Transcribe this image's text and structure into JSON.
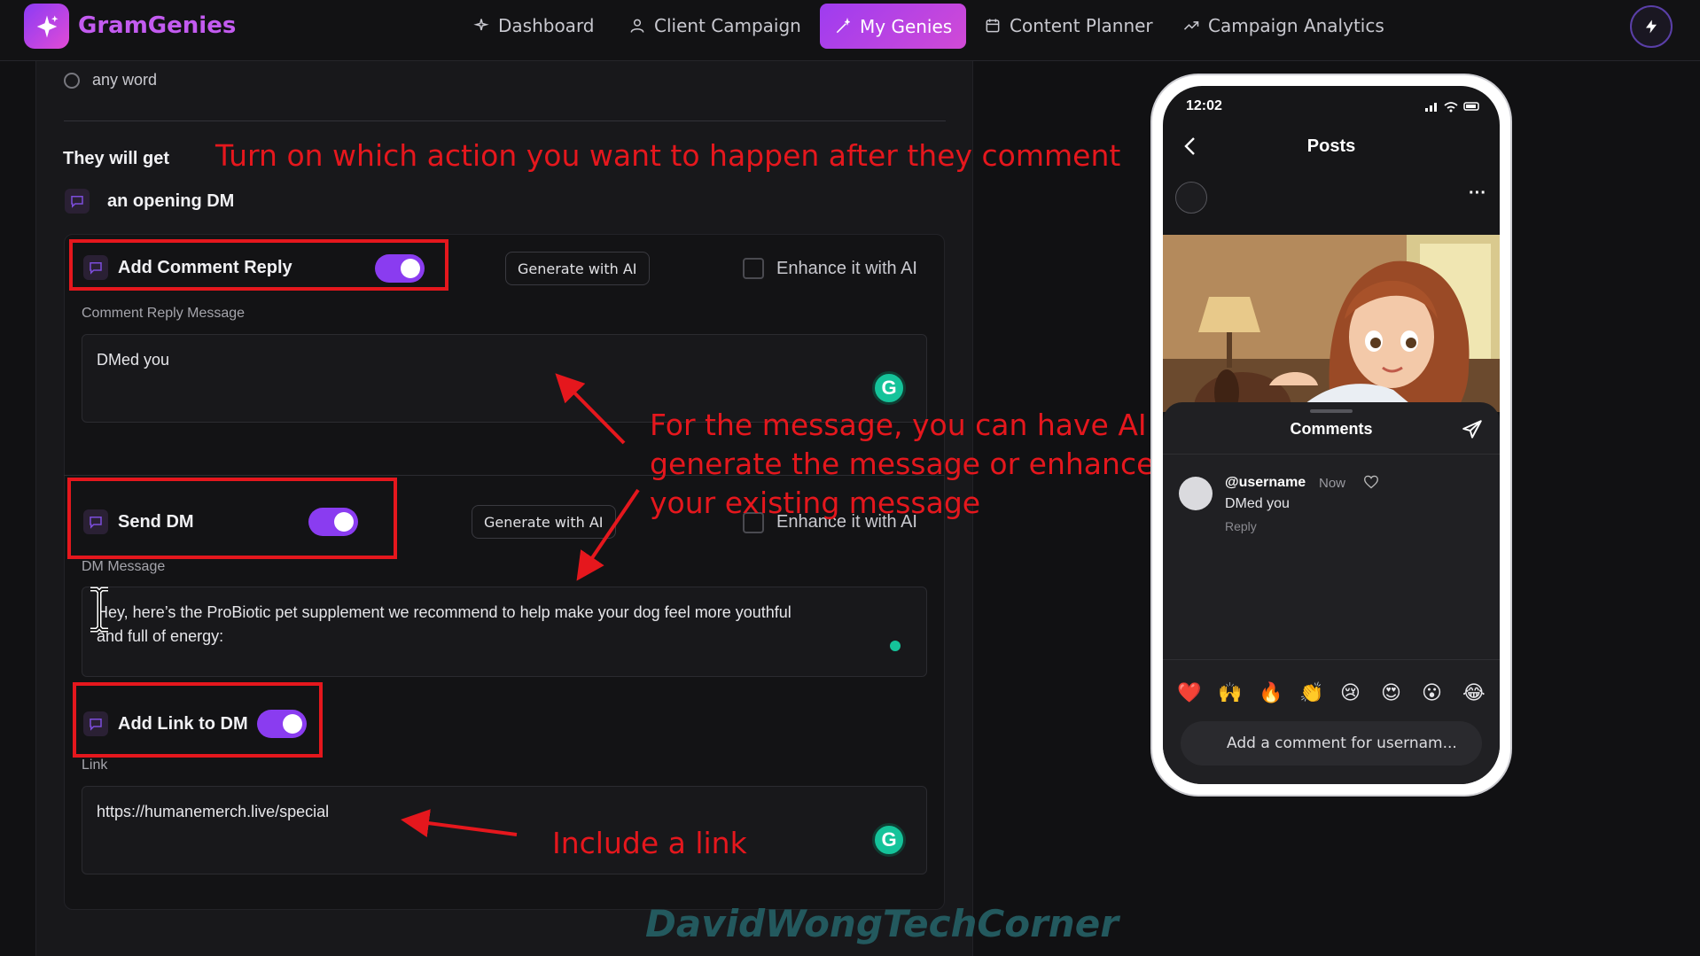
{
  "app": {
    "name": "GramGenies",
    "nav": [
      {
        "label": "Dashboard",
        "icon": "sparkles-icon",
        "active": false
      },
      {
        "label": "Client Campaign",
        "icon": "person-icon",
        "active": false
      },
      {
        "label": "My Genies",
        "icon": "magic-wand-icon",
        "active": true
      },
      {
        "label": "Content Planner",
        "icon": "calendar-icon",
        "active": false
      },
      {
        "label": "Campaign Analytics",
        "icon": "trend-icon",
        "active": false
      }
    ],
    "quick_action_icon": "lightning-icon"
  },
  "trigger": {
    "option_label": "any word"
  },
  "actions": {
    "heading": "They will get",
    "opening_dm_label": "an opening DM",
    "generate_label": "Generate with AI",
    "enhance_label": "Enhance it with AI",
    "comment_reply": {
      "label": "Add Comment Reply",
      "enabled": true,
      "field_label": "Comment Reply Message",
      "value": "DMed you"
    },
    "send_dm": {
      "label": "Send DM",
      "enabled": true,
      "field_label": "DM Message",
      "value_line1": "Hey, here’s the ProBiotic pet supplement we recommend to help make your dog feel more youthful",
      "value_line2": "and full of energy:"
    },
    "add_link": {
      "label": "Add Link to DM",
      "enabled": true,
      "field_label": "Link",
      "value": "https://humanemerch.live/special"
    }
  },
  "annotations": {
    "top": "Turn on which action you want to happen after they comment",
    "message_line1": "For the message, you can have AI",
    "message_line2": "generate the message or enhance",
    "message_line3": "your existing message",
    "link": "Include a link",
    "color": "#e5171d"
  },
  "watermark": "DavidWongTechCorner",
  "phone": {
    "time": "12:02",
    "header": "Posts",
    "comments_title": "Comments",
    "comment": {
      "username": "@username",
      "time": "Now",
      "text": "DMed you",
      "reply": "Reply"
    },
    "reactions": [
      "❤️",
      "🙌",
      "🔥",
      "👏",
      "😢",
      "😍",
      "😮",
      "😂"
    ],
    "input_placeholder": "Add a comment for usernam..."
  },
  "colors": {
    "accent": "#8a3cf0",
    "brand_gradient_start": "#9e3cf0",
    "brand_gradient_end": "#d14ad6",
    "background": "#111113",
    "panel": "#18181b"
  }
}
